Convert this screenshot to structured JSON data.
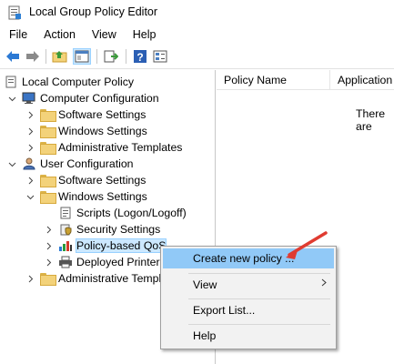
{
  "window": {
    "title": "Local Group Policy Editor"
  },
  "menubar": {
    "items": [
      "File",
      "Action",
      "View",
      "Help"
    ]
  },
  "tree": {
    "items": [
      {
        "label": "Local Computer Policy"
      },
      {
        "label": "Computer Configuration"
      },
      {
        "label": "Software Settings"
      },
      {
        "label": "Windows Settings"
      },
      {
        "label": "Administrative Templates"
      },
      {
        "label": "User Configuration"
      },
      {
        "label": "Software Settings"
      },
      {
        "label": "Windows Settings"
      },
      {
        "label": "Scripts (Logon/Logoff)"
      },
      {
        "label": "Security Settings"
      },
      {
        "label": "Policy-based QoS"
      },
      {
        "label": "Deployed Printers"
      },
      {
        "label": "Administrative Templates"
      }
    ]
  },
  "list": {
    "columns": [
      "Policy Name",
      "Application"
    ],
    "empty_text": "There are"
  },
  "context_menu": {
    "items": [
      "Create new policy ...",
      "View",
      "Export List...",
      "Help"
    ],
    "submenu_arrow": ">"
  },
  "colors": {
    "selection": "#cce8ff",
    "menu_highlight": "#91c9f7",
    "annotation_arrow": "#e03c31"
  }
}
